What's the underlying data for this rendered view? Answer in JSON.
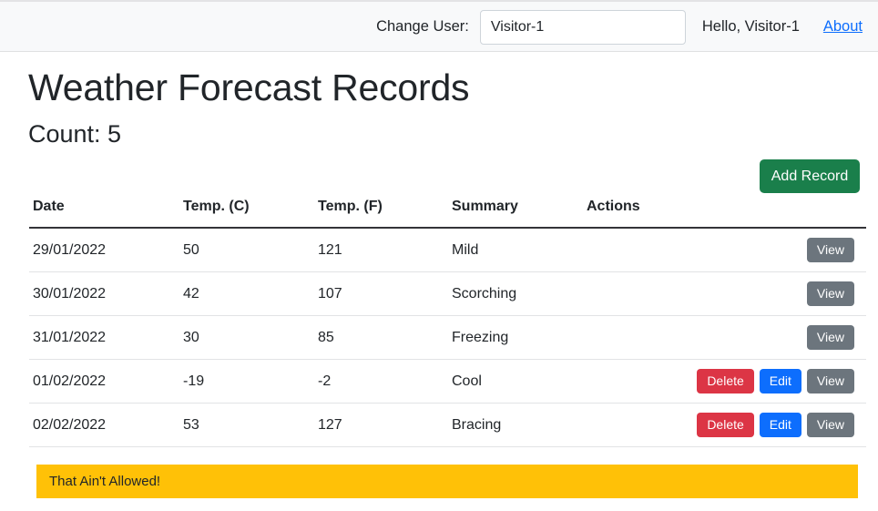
{
  "navbar": {
    "change_user_label": "Change User:",
    "user_input_value": "Visitor-1",
    "user_input_placeholder": "",
    "greeting": "Hello, Visitor-1",
    "about_link": "About"
  },
  "page": {
    "title": "Weather Forecast Records",
    "count_line": "Count: 5"
  },
  "toolbar": {
    "add_record_label": "Add Record"
  },
  "table": {
    "headers": [
      "Date",
      "Temp. (C)",
      "Temp. (F)",
      "Summary",
      "Actions"
    ],
    "rows": [
      {
        "date": "29/01/2022",
        "temp_c": "50",
        "temp_f": "121",
        "summary": "Mild",
        "actions": [
          "View"
        ]
      },
      {
        "date": "30/01/2022",
        "temp_c": "42",
        "temp_f": "107",
        "summary": "Scorching",
        "actions": [
          "View"
        ]
      },
      {
        "date": "31/01/2022",
        "temp_c": "30",
        "temp_f": "85",
        "summary": "Freezing",
        "actions": [
          "View"
        ]
      },
      {
        "date": "01/02/2022",
        "temp_c": "-19",
        "temp_f": "-2",
        "summary": "Cool",
        "actions": [
          "Delete",
          "Edit",
          "View"
        ]
      },
      {
        "date": "02/02/2022",
        "temp_c": "53",
        "temp_f": "127",
        "summary": "Bracing",
        "actions": [
          "Delete",
          "Edit",
          "View"
        ]
      }
    ]
  },
  "alert": {
    "message": "That Ain't Allowed!",
    "color": "#ffc107"
  },
  "colors": {
    "success": "#1a7f4b",
    "danger": "#dc3545",
    "primary": "#0d6efd",
    "secondary": "#6c757d",
    "warning": "#ffc107",
    "navbar_bg": "#f8f9fa"
  }
}
